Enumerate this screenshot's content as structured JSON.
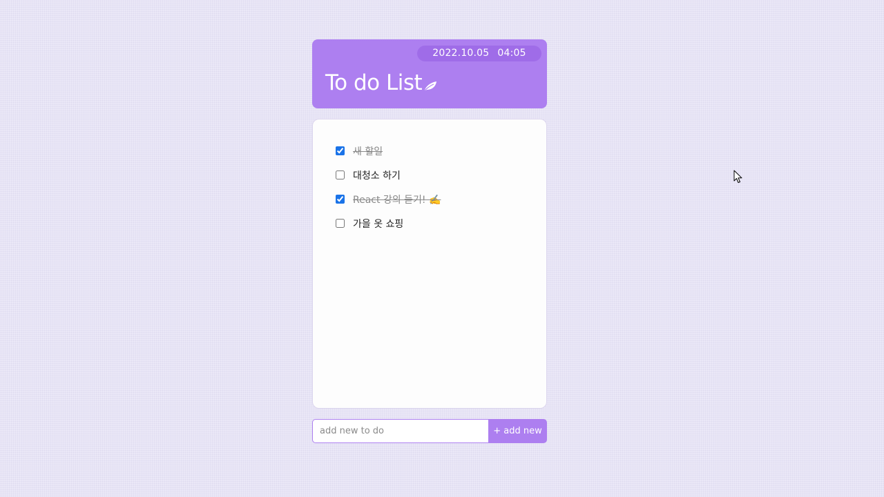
{
  "header": {
    "date": "2022.10.05",
    "time": "04:05",
    "title": "To do List",
    "title_icon": "leaf-icon",
    "accent_color": "#ad7ff0"
  },
  "todos": [
    {
      "text": "새 할일",
      "done": true
    },
    {
      "text": "대청소 하기",
      "done": false
    },
    {
      "text": "React 강의 듣기! ✍️",
      "done": true
    },
    {
      "text": "가을 옷 쇼핑",
      "done": false
    }
  ],
  "add_form": {
    "placeholder": "add new to do",
    "value": "",
    "button_label": "+ add new"
  },
  "cursor_icon": "mouse-pointer-icon"
}
